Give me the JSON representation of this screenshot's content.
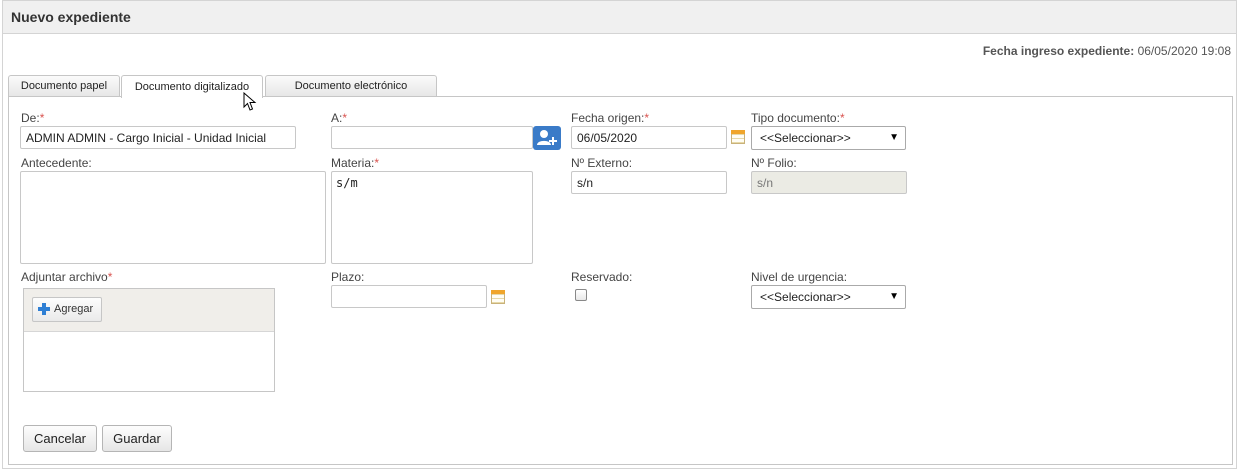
{
  "header": {
    "title": "Nuevo expediente"
  },
  "fecha_ingreso": {
    "label": "Fecha ingreso expediente:",
    "value": "06/05/2020 19:08"
  },
  "tabs": [
    {
      "label": "Documento papel",
      "active": false
    },
    {
      "label": "Documento digitalizado",
      "active": true
    },
    {
      "label": "Documento electrónico",
      "active": false
    }
  ],
  "form": {
    "de": {
      "label": "De:",
      "required": "*",
      "value": "ADMIN ADMIN - Cargo Inicial - Unidad Inicial"
    },
    "a": {
      "label": "A:",
      "required": "*",
      "value": ""
    },
    "fecha_origen": {
      "label": "Fecha origen:",
      "required": "*",
      "value": "06/05/2020"
    },
    "tipo_documento": {
      "label": "Tipo documento:",
      "required": "*",
      "selected": "<<Seleccionar>>"
    },
    "antecedente": {
      "label": "Antecedente:",
      "value": ""
    },
    "materia": {
      "label": "Materia:",
      "required": "*",
      "value": "s/m"
    },
    "n_externo": {
      "label": "Nº Externo:",
      "value": "s/n"
    },
    "n_folio": {
      "label": "Nº Folio:",
      "value": "s/n"
    },
    "adjuntar": {
      "label": "Adjuntar archivo",
      "required": "*",
      "add_label": "Agregar"
    },
    "plazo": {
      "label": "Plazo:",
      "value": ""
    },
    "reservado": {
      "label": "Reservado:",
      "checked": false
    },
    "nivel_urgencia": {
      "label": "Nivel de urgencia:",
      "selected": "<<Seleccionar>>"
    }
  },
  "actions": {
    "cancel": "Cancelar",
    "save": "Guardar"
  },
  "colors": {
    "accent": "#3a7bc8",
    "required": "#d9534f",
    "add_icon": "#2f7fd4"
  }
}
